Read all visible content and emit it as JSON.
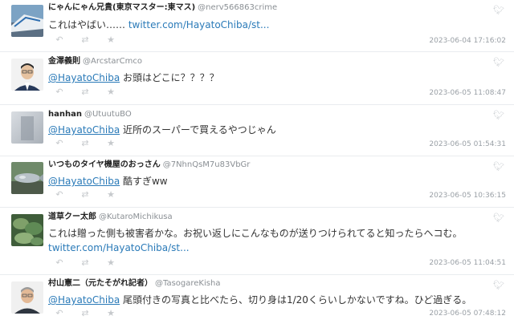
{
  "tweets": [
    {
      "display_name": "にゃんにゃん兄貴(東京マスター:東マス)",
      "handle": "@nerv566863crime",
      "text_before": "これはやばい…… ",
      "link": "twitter.com/HayatoChiba/st...",
      "timestamp": "2023-06-04 17:16:02"
    },
    {
      "display_name": "金澤義則",
      "handle": "@ArcstarCmco",
      "mention": "@HayatoChiba",
      "text": " お頭はどこに？？？？",
      "timestamp": "2023-06-05 11:08:47"
    },
    {
      "display_name": "hanhan",
      "handle": "@UtuutuBO",
      "mention": "@HayatoChiba",
      "text": " 近所のスーパーで買えるやつじゃん",
      "timestamp": "2023-06-05 01:54:31"
    },
    {
      "display_name": "いつものタイヤ機屋のおっさん",
      "handle": "@7NhnQsM7u83VbGr",
      "mention": "@HayatoChiba",
      "text": " 酷すぎww",
      "timestamp": "2023-06-05 10:36:15"
    },
    {
      "display_name": "道草クー太郎",
      "handle": "@KutaroMichikusa",
      "text_line1": "これは贈った側も被害者かな。お祝い返しにこんなものが送りつけられてると知ったらヘコむ。",
      "link": "twitter.com/HayatoChiba/st...",
      "timestamp": "2023-06-05 11:04:51"
    },
    {
      "display_name": "村山憲二（元たそがれ記者）",
      "handle": "@TasogareKisha",
      "mention": "@HayatoChiba",
      "text": " 尾頭付きの写真と比べたら、切り身は1/20くらいしかないですね。ひど過ぎる。",
      "timestamp": "2023-06-05 07:48:12"
    }
  ],
  "icons": {
    "reply": "↶",
    "retweet": "⇄",
    "favorite": "★",
    "bird": "twitter-bird"
  },
  "colors": {
    "link": "#2a7ab8",
    "muted": "#9aa0a6",
    "divider": "#e9ecef"
  }
}
